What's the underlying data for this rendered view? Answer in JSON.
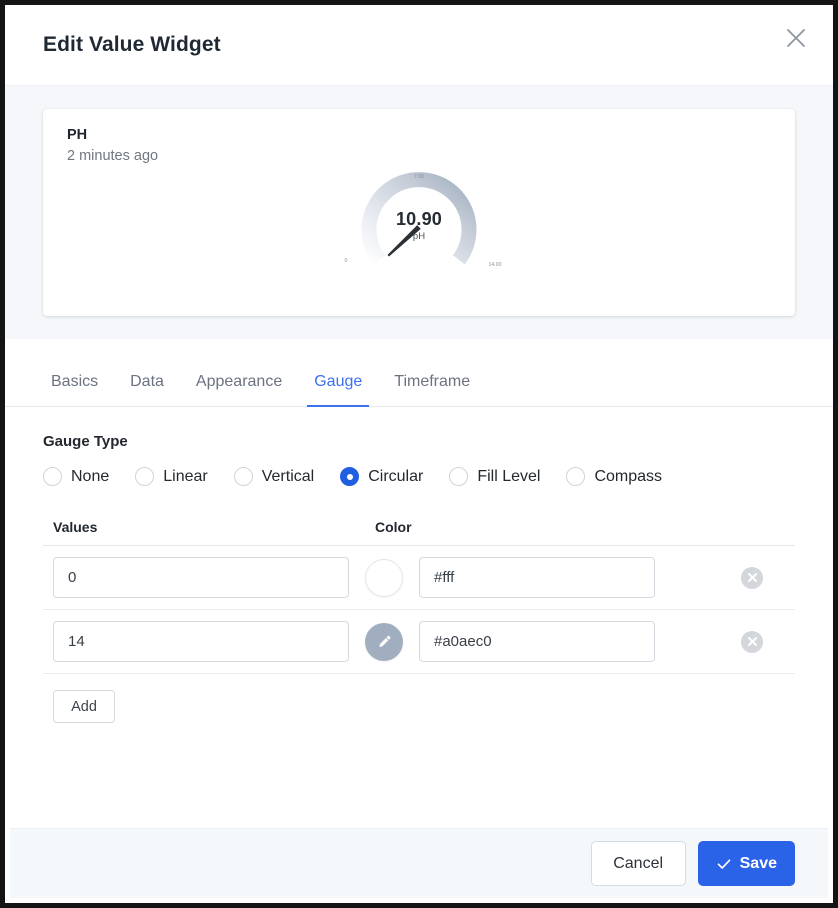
{
  "dialog": {
    "title": "Edit Value Widget",
    "close_icon": "close-icon"
  },
  "preview": {
    "widget_title": "PH",
    "timestamp": "2 minutes ago",
    "gauge": {
      "value_text": "10.90",
      "unit": "pH",
      "min_label": "0",
      "mid_label": "7.00",
      "max_label": "14.00",
      "min": 0,
      "max": 14,
      "value": 10.9,
      "arc_start_color": "#fbfcfd",
      "arc_end_color": "#a0aec0",
      "needle_color": "#2b2f36"
    }
  },
  "tabs": [
    {
      "label": "Basics",
      "active": false
    },
    {
      "label": "Data",
      "active": false
    },
    {
      "label": "Appearance",
      "active": false
    },
    {
      "label": "Gauge",
      "active": true
    },
    {
      "label": "Timeframe",
      "active": false
    }
  ],
  "gauge_type": {
    "label": "Gauge Type",
    "options": [
      {
        "label": "None",
        "selected": false
      },
      {
        "label": "Linear",
        "selected": false
      },
      {
        "label": "Vertical",
        "selected": false
      },
      {
        "label": "Circular",
        "selected": true
      },
      {
        "label": "Fill Level",
        "selected": false
      },
      {
        "label": "Compass",
        "selected": false
      }
    ],
    "accent_color": "#1f5fe0"
  },
  "values_table": {
    "headers": {
      "values": "Values",
      "color": "Color"
    },
    "rows": [
      {
        "value": "0",
        "color_text": "#fff",
        "swatch_color": "#ffffff",
        "has_edit_icon": false,
        "delete_icon": "close-circle-icon"
      },
      {
        "value": "14",
        "color_text": "#a0aec0",
        "swatch_color": "#a0aec0",
        "has_edit_icon": true,
        "delete_icon": "close-circle-icon"
      }
    ],
    "add_label": "Add"
  },
  "footer": {
    "cancel_label": "Cancel",
    "save_label": "Save",
    "save_icon": "check-icon",
    "save_color": "#2b63e8"
  }
}
